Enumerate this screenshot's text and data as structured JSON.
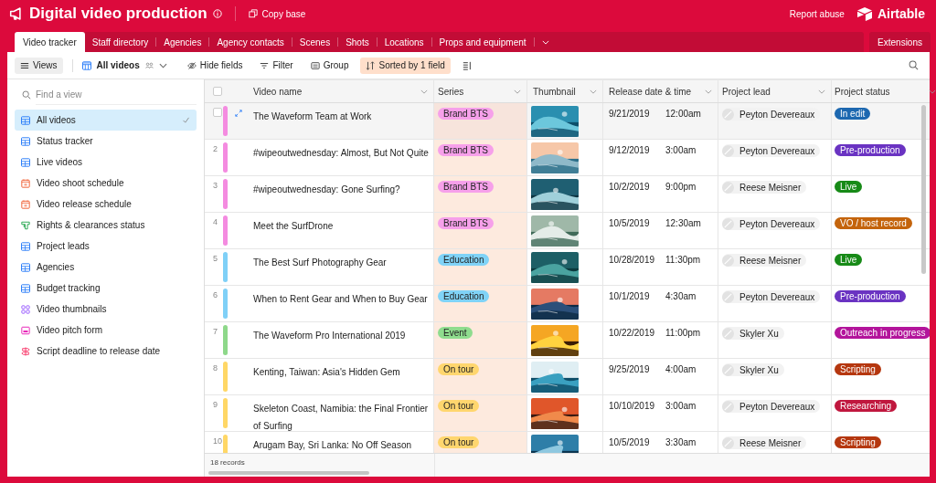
{
  "base": {
    "title": "Digital video production",
    "copy": "Copy base",
    "report": "Report abuse",
    "brand": "Airtable"
  },
  "tabs": [
    {
      "label": "Video tracker",
      "selected": true
    },
    {
      "label": "Staff directory",
      "selected": false
    },
    {
      "label": "Agencies",
      "selected": false
    },
    {
      "label": "Agency contacts",
      "selected": false
    },
    {
      "label": "Scenes",
      "selected": false
    },
    {
      "label": "Shots",
      "selected": false
    },
    {
      "label": "Locations",
      "selected": false
    },
    {
      "label": "Props and equipment",
      "selected": false
    }
  ],
  "extensions": "Extensions",
  "toolbar": {
    "views": "Views",
    "view": "All videos",
    "items": [
      {
        "kind": "hide",
        "label": "Hide fields",
        "active": false
      },
      {
        "kind": "filter",
        "label": "Filter",
        "active": false
      },
      {
        "kind": "group",
        "label": "Group",
        "active": false
      },
      {
        "kind": "sort",
        "label": "Sorted by 1 field",
        "active": true
      }
    ]
  },
  "sidebar": {
    "placeholder": "Find a view",
    "items": [
      {
        "kind": "grid",
        "label": "All videos",
        "selected": true
      },
      {
        "kind": "grid",
        "label": "Status tracker",
        "selected": false
      },
      {
        "kind": "grid",
        "label": "Live videos",
        "selected": false
      },
      {
        "kind": "calendar",
        "label": "Video shoot schedule",
        "selected": false
      },
      {
        "kind": "calendar",
        "label": "Video release schedule",
        "selected": false
      },
      {
        "kind": "kanban",
        "label": "Rights & clearances status",
        "selected": false
      },
      {
        "kind": "grid",
        "label": "Project leads",
        "selected": false
      },
      {
        "kind": "grid",
        "label": "Agencies",
        "selected": false
      },
      {
        "kind": "grid",
        "label": "Budget tracking",
        "selected": false
      },
      {
        "kind": "gallery",
        "label": "Video thumbnails",
        "selected": false
      },
      {
        "kind": "form",
        "label": "Video pitch form",
        "selected": false
      },
      {
        "kind": "timeline",
        "label": "Script deadline to release date",
        "selected": false
      }
    ]
  },
  "table": {
    "select_all": {
      "checked": false
    },
    "columns": [
      {
        "label": "Video name",
        "sorted": false
      },
      {
        "label": "Series",
        "sorted": true
      },
      {
        "label": "Thumbnail",
        "sorted": false
      },
      {
        "label": "Release date & time",
        "sorted": false
      },
      {
        "label": "Project lead",
        "sorted": false
      },
      {
        "label": "Project status",
        "sorted": false
      }
    ],
    "rows": [
      {
        "selected": true,
        "color": "#f48be0",
        "name": "The Waveform Team at Work",
        "series": {
          "label": "Brand BTS",
          "color": "#f6a0ea"
        },
        "date": "9/21/2019",
        "time": "12:00am",
        "lead": "Peyton Devereaux",
        "status": {
          "label": "In edit",
          "color": "#1d68b0"
        }
      },
      {
        "number": "2",
        "selected": false,
        "color": "#f48be0",
        "name": "#wipeoutwednesday: Almost, But Not Quite",
        "series": {
          "label": "Brand BTS",
          "color": "#f6a0ea"
        },
        "date": "9/12/2019",
        "time": "3:00am",
        "lead": "Peyton Devereaux",
        "status": {
          "label": "Pre-production",
          "color": "#6a33c2"
        }
      },
      {
        "number": "3",
        "selected": false,
        "color": "#f48be0",
        "name": "#wipeoutwednesday: Gone Surfing?",
        "series": {
          "label": "Brand BTS",
          "color": "#f6a0ea"
        },
        "date": "10/2/2019",
        "time": "9:00pm",
        "lead": "Reese Meisner",
        "status": {
          "label": "Live",
          "color": "#178a17"
        }
      },
      {
        "number": "4",
        "selected": false,
        "color": "#f48be0",
        "name": "Meet the SurfDrone",
        "series": {
          "label": "Brand BTS",
          "color": "#f6a0ea"
        },
        "date": "10/5/2019",
        "time": "12:30am",
        "lead": "Peyton Devereaux",
        "status": {
          "label": "VO / host record",
          "color": "#c4640c"
        }
      },
      {
        "number": "5",
        "selected": false,
        "color": "#7fd0f7",
        "name": "The Best Surf Photography Gear",
        "series": {
          "label": "Education",
          "color": "#80d3f7"
        },
        "date": "10/28/2019",
        "time": "11:30pm",
        "lead": "Reese Meisner",
        "status": {
          "label": "Live",
          "color": "#178a17"
        }
      },
      {
        "number": "6",
        "selected": false,
        "color": "#7fd0f7",
        "name": "When to Rent Gear and When to Buy Gear",
        "series": {
          "label": "Education",
          "color": "#80d3f7"
        },
        "date": "10/1/2019",
        "time": "4:30am",
        "lead": "Peyton Devereaux",
        "status": {
          "label": "Pre-production",
          "color": "#6a33c2"
        }
      },
      {
        "number": "7",
        "selected": false,
        "color": "#8ed88a",
        "name": "The Waveform Pro International 2019",
        "series": {
          "label": "Event",
          "color": "#8fdc8e"
        },
        "date": "10/22/2019",
        "time": "11:00pm",
        "lead": "Skyler Xu",
        "status": {
          "label": "Outreach in progress",
          "color": "#b3149b"
        }
      },
      {
        "number": "8",
        "selected": false,
        "color": "#ffd766",
        "name": "Kenting, Taiwan: Asia's Hidden Gem",
        "series": {
          "label": "On tour",
          "color": "#ffd66e"
        },
        "date": "9/25/2019",
        "time": "4:00am",
        "lead": "Skyler Xu",
        "status": {
          "label": "Scripting",
          "color": "#b5370f"
        }
      },
      {
        "number": "9",
        "selected": false,
        "color": "#ffd766",
        "name": "Skeleton Coast, Namibia: the Final Frontier of Surfing",
        "series": {
          "label": "On tour",
          "color": "#ffd66e"
        },
        "date": "10/10/2019",
        "time": "3:00am",
        "lead": "Peyton Devereaux",
        "status": {
          "label": "Researching",
          "color": "#c0173e"
        }
      },
      {
        "number": "10",
        "selected": false,
        "color": "#ffd766",
        "name": "Arugam Bay, Sri Lanka: No Off Season",
        "series": {
          "label": "On tour",
          "color": "#ffd66e"
        },
        "date": "10/5/2019",
        "time": "3:30am",
        "lead": "Reese Meisner",
        "status": {
          "label": "Scripting",
          "color": "#b5370f"
        }
      }
    ],
    "footer": "18 records"
  }
}
